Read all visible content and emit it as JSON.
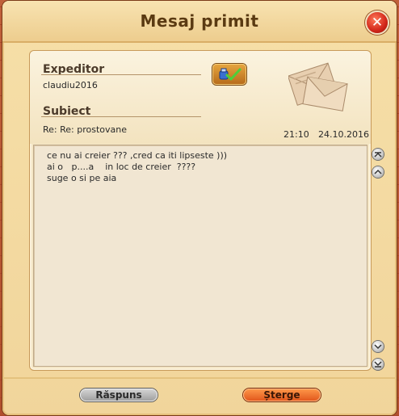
{
  "window": {
    "title": "Mesaj primit"
  },
  "header": {
    "sender_label": "Expeditor",
    "sender_value": "claudiu2016",
    "subject_label": "Subiect",
    "subject_value": "Re: Re: prostovane",
    "time": "21:10",
    "date": "24.10.2016"
  },
  "message": {
    "lines": [
      "ce nu ai creier ??? ,cred ca iti lipseste )))",
      "ai o   p....a    in loc de creier  ????",
      "suge o si pe aia"
    ]
  },
  "buttons": {
    "reply": "Răspuns",
    "delete": "Șterge"
  },
  "colors": {
    "accent_orange": "#e0541a",
    "close_red": "#d2261a",
    "title_text": "#5a3a12"
  },
  "icons": {
    "close": "close-icon",
    "compose": "compose-icon",
    "envelope": "envelope-icon"
  }
}
